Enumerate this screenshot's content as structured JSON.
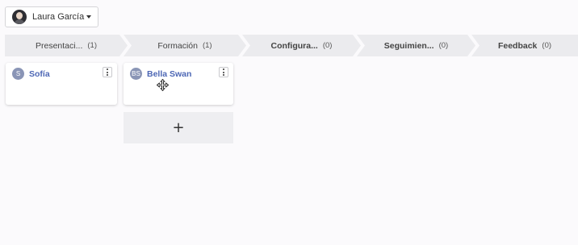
{
  "user": {
    "name": "Laura García",
    "icon": "avatar-photo"
  },
  "stages": [
    {
      "name": "Presentaci...",
      "count": "(1)",
      "bold": false
    },
    {
      "name": "Formación",
      "count": "(1)",
      "bold": false
    },
    {
      "name": "Configura...",
      "count": "(0)",
      "bold": true
    },
    {
      "name": "Seguimien...",
      "count": "(0)",
      "bold": true
    },
    {
      "name": "Feedback",
      "count": "(0)",
      "bold": true
    }
  ],
  "cards": [
    {
      "initials": "S",
      "name": "Sofía"
    },
    {
      "initials": "BS",
      "name": "Bella Swan"
    }
  ],
  "add_card": {
    "label": "+"
  }
}
